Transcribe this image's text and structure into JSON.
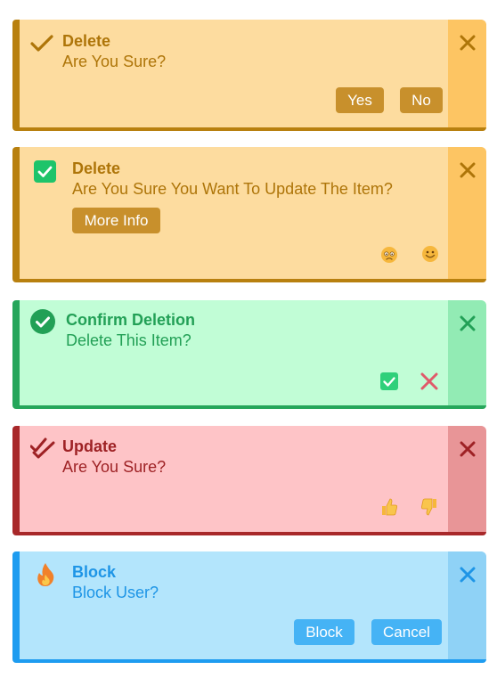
{
  "colors": {
    "warning_text": "#ae7509",
    "warning_bg": "#fddc9f",
    "warning_btn": "#c8902c",
    "success_text": "#22a056",
    "success_bg": "#c1fdd6",
    "danger_text": "#9e2225",
    "danger_bg": "#fec4c7",
    "info_text": "#1e95e6",
    "info_bg": "#b3e5fc",
    "info_btn": "#45b3f5"
  },
  "cards": [
    {
      "icon": "checkmark-icon",
      "title": "Delete",
      "message": "Are You Sure?",
      "buttons": [
        "Yes",
        "No"
      ],
      "close_icon": "close-icon"
    },
    {
      "icon": "checkbox-checked-icon",
      "title": "Delete",
      "message": "Are You Sure You Want To Update The Item?",
      "more_info": "More Info",
      "actions": [
        "sad-face-icon",
        "smiley-face-icon"
      ],
      "close_icon": "close-icon"
    },
    {
      "icon": "check-circle-icon",
      "title": "Confirm Deletion",
      "message": "Delete This Item?",
      "actions": [
        "checkbox-confirm-icon",
        "cross-cancel-icon"
      ],
      "close_icon": "close-icon"
    },
    {
      "icon": "double-check-icon",
      "title": "Update",
      "message": "Are You Sure?",
      "actions": [
        "thumbs-up-icon",
        "thumbs-down-icon"
      ],
      "close_icon": "close-icon"
    },
    {
      "icon": "fire-icon",
      "title": "Block",
      "message": "Block User?",
      "buttons": [
        "Block",
        "Cancel"
      ],
      "close_icon": "close-icon"
    }
  ]
}
